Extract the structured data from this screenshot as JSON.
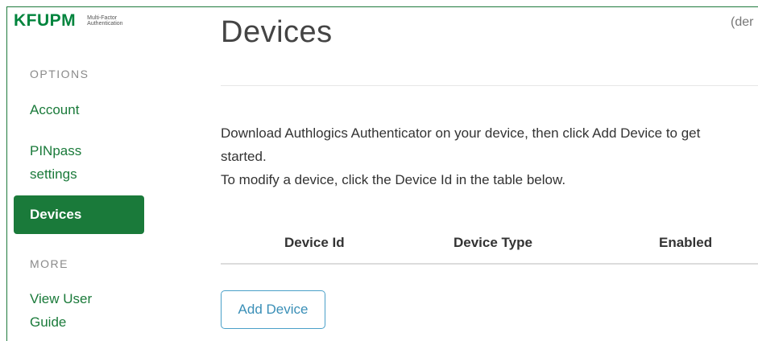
{
  "brand": {
    "name": "KFUPM",
    "tagline_line1": "Multi-Factor",
    "tagline_line2": "Authentication"
  },
  "sidebar": {
    "options_label": "OPTIONS",
    "items": [
      {
        "label": "Account"
      },
      {
        "label_line1": "PINpass",
        "label_line2": "settings"
      },
      {
        "label": "Devices",
        "active": true
      }
    ],
    "more_label": "MORE",
    "more_items": [
      {
        "label_line1": "View User",
        "label_line2": "Guide"
      }
    ]
  },
  "header": {
    "title": "Devices",
    "user_hint": "(der"
  },
  "main": {
    "intro_line1": "Download Authlogics Authenticator on your device, then click Add Device to get",
    "intro_line2": "started.",
    "intro_line3": "To modify a device, click the Device Id in the table below.",
    "table_headers": [
      "Device Id",
      "Device Type",
      "Enabled"
    ],
    "add_button_label": "Add Device"
  },
  "colors": {
    "brand_green": "#1a7a3a",
    "button_blue": "#3a8fb7"
  }
}
